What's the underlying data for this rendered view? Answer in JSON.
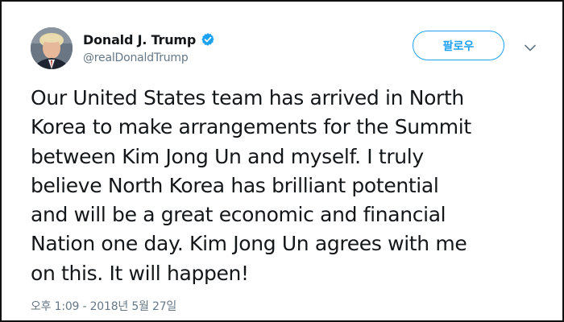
{
  "author": {
    "display_name": "Donald J. Trump",
    "handle": "@realDonaldTrump",
    "verified": true,
    "avatar_icon": "profile-avatar"
  },
  "actions": {
    "follow_label": "팔로우",
    "more_icon": "chevron-down-icon"
  },
  "tweet": {
    "text": "Our United States team has arrived in North\nKorea to make arrangements for the Summit\nbetween Kim Jong Un and myself. I truly\nbelieve North Korea has brilliant potential\nand will be a great economic and financial\nNation one day. Kim Jong Un agrees with me\non this. It will happen!",
    "timestamp": "오후 1:09 - 2018년 5월 27일"
  },
  "colors": {
    "accent": "#1da1f2",
    "text_primary": "#14171a",
    "text_secondary": "#657786",
    "border": "#111111"
  }
}
